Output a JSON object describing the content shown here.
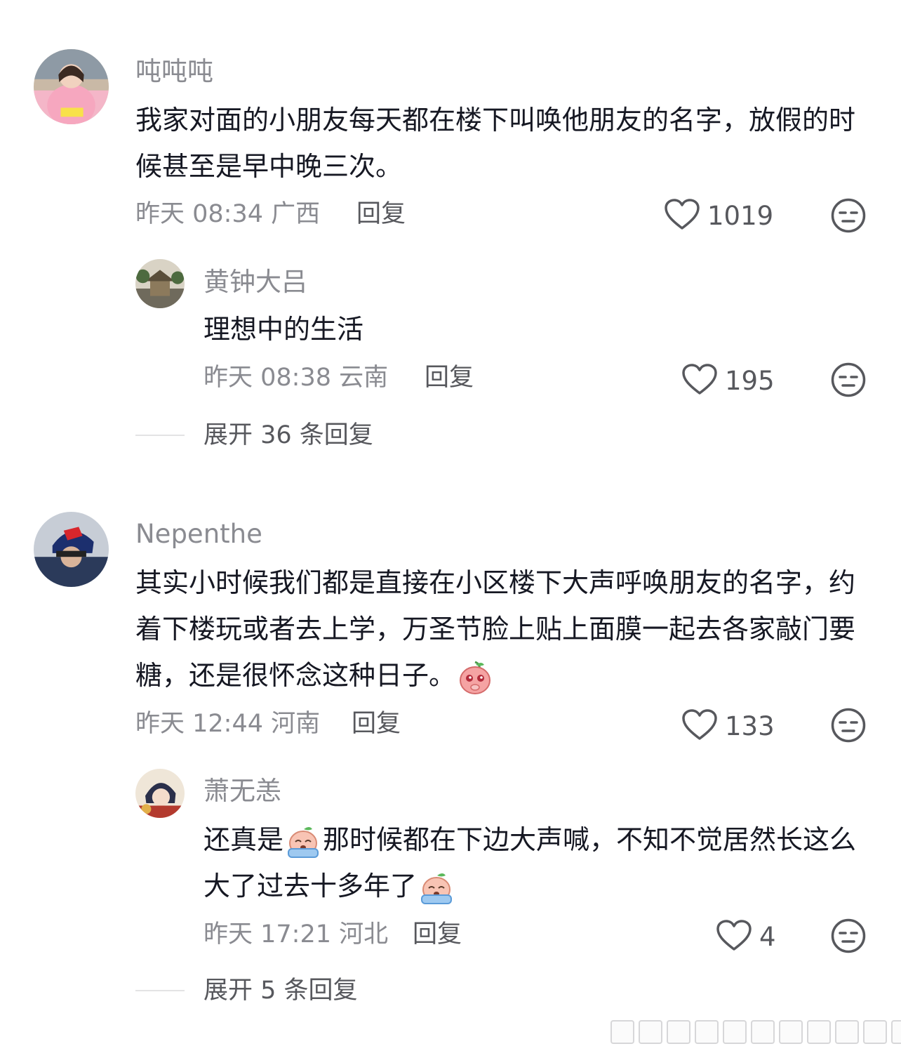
{
  "comments": [
    {
      "username": "吨吨吨",
      "text": "我家对面的小朋友每天都在楼下叫唤他朋友的名字，放假的时候甚至是早中晚三次。",
      "meta": "昨天 08:34 广西",
      "reply_label": "回复",
      "likes": "1019",
      "replies": [
        {
          "username": "黄钟大吕",
          "text": "理想中的生活",
          "meta": "昨天 08:38 云南",
          "reply_label": "回复",
          "likes": "195"
        }
      ],
      "expand_label": "展开 36 条回复"
    },
    {
      "username": "Nepenthe",
      "text_before_emoji": "其实小时候我们都是直接在小区楼下大声呼唤朋友的名字，约着下楼玩或者去上学，万圣节脸上贴上面膜一起去各家敲门要糖，还是很怀念这种日子。",
      "emoji": "shy-peach-emoji",
      "meta": "昨天 12:44 河南",
      "reply_label": "回复",
      "likes": "133",
      "replies": [
        {
          "username": "萧无恙",
          "text_part1": "还真是",
          "emoji1": "crying-peach-emoji",
          "text_part2": "那时候都在下边大声喊，不知不觉居然长这么大了过去十多年了",
          "emoji2": "crying-peach-emoji",
          "meta": "昨天 17:21 河北",
          "reply_label": "回复",
          "likes": "4"
        }
      ],
      "expand_label": "展开 5 条回复"
    }
  ],
  "icons": {
    "like": "heart-outline-icon",
    "dislike": "neutral-face-icon"
  },
  "colors": {
    "primary_text": "#161823",
    "secondary_text": "#8a8b91",
    "action_text": "#57585d",
    "divider": "#e3e3e4",
    "background": "#ffffff"
  }
}
